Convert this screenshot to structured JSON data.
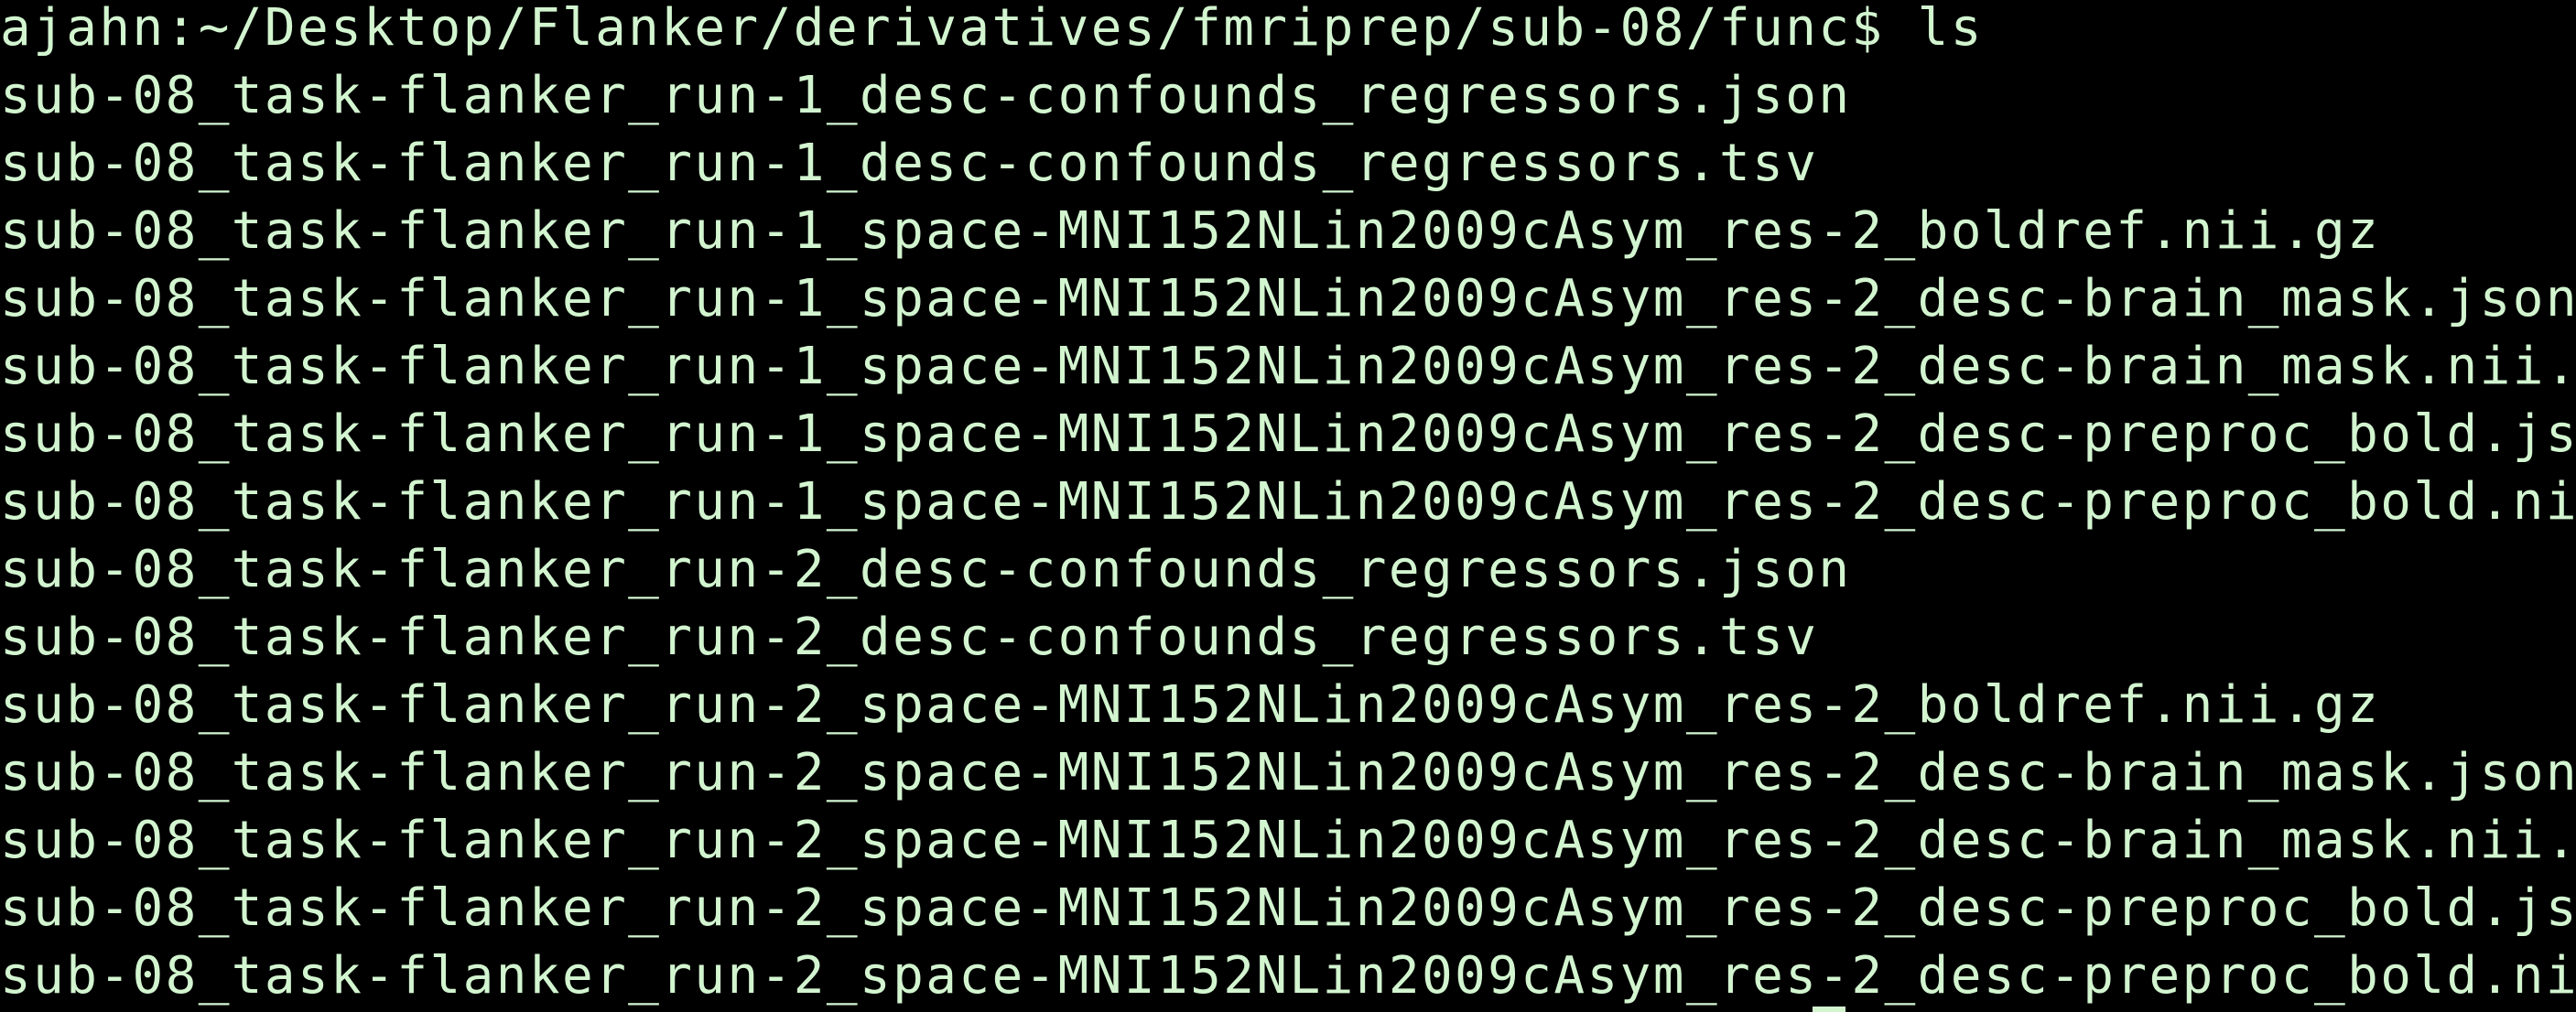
{
  "terminal": {
    "prompt": "ajahn:~/Desktop/Flanker/derivatives/fmriprep/sub-08/func$ ls",
    "output": [
      "sub-08_task-flanker_run-1_desc-confounds_regressors.json",
      "sub-08_task-flanker_run-1_desc-confounds_regressors.tsv",
      "sub-08_task-flanker_run-1_space-MNI152NLin2009cAsym_res-2_boldref.nii.gz",
      "sub-08_task-flanker_run-1_space-MNI152NLin2009cAsym_res-2_desc-brain_mask.json",
      "sub-08_task-flanker_run-1_space-MNI152NLin2009cAsym_res-2_desc-brain_mask.nii.gz",
      "sub-08_task-flanker_run-1_space-MNI152NLin2009cAsym_res-2_desc-preproc_bold.json",
      "sub-08_task-flanker_run-1_space-MNI152NLin2009cAsym_res-2_desc-preproc_bold.nii.gz",
      "sub-08_task-flanker_run-2_desc-confounds_regressors.json",
      "sub-08_task-flanker_run-2_desc-confounds_regressors.tsv",
      "sub-08_task-flanker_run-2_space-MNI152NLin2009cAsym_res-2_boldref.nii.gz",
      "sub-08_task-flanker_run-2_space-MNI152NLin2009cAsym_res-2_desc-brain_mask.json",
      "sub-08_task-flanker_run-2_space-MNI152NLin2009cAsym_res-2_desc-brain_mask.nii.gz",
      "sub-08_task-flanker_run-2_space-MNI152NLin2009cAsym_res-2_desc-preproc_bold.json",
      "sub-08_task-flanker_run-2_space-MNI152NLin2009cAsym_res-2_desc-preproc_bold.nii.gz"
    ]
  },
  "colors": {
    "background": "#000000",
    "text": "#d2f5d0"
  }
}
